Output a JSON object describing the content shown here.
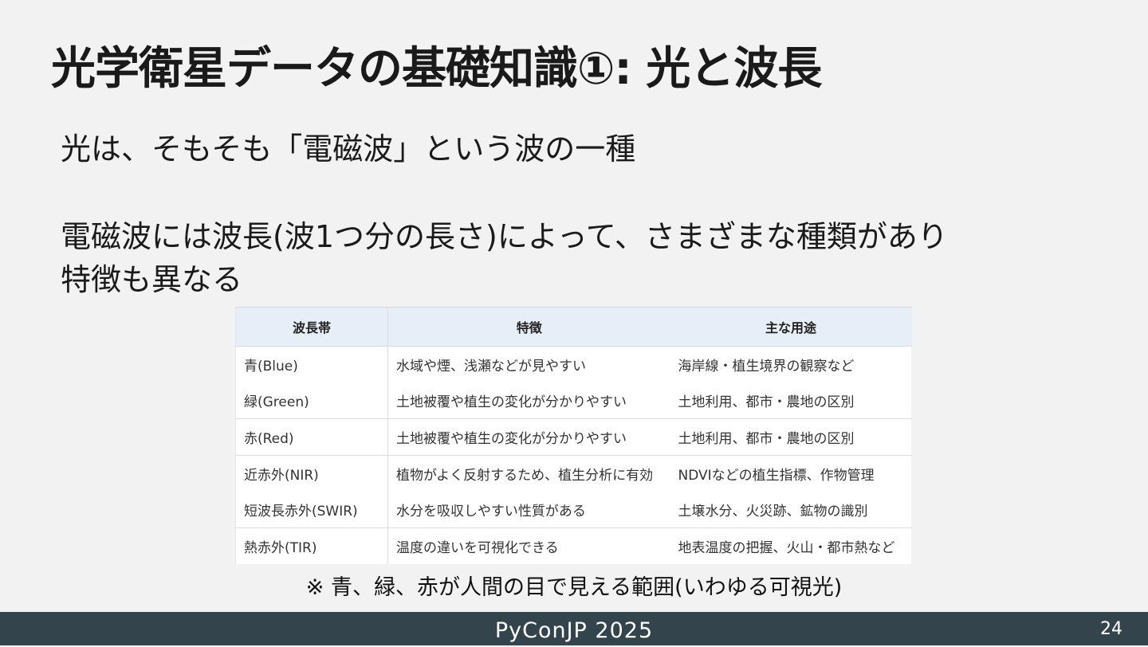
{
  "slide": {
    "title": "光学衛星データの基礎知識①: 光と波長",
    "line1": "光は、そもそも「電磁波」という波の一種",
    "line2": "電磁波には波長(波1つ分の長さ)によって、さまざまな種類があり",
    "line3": "特徴も異なる"
  },
  "table": {
    "headers": [
      "波長帯",
      "特徴",
      "主な用途"
    ],
    "rows": [
      [
        "青(Blue)",
        "水域や煙、浅瀬などが見やすい",
        "海岸線・植生境界の観察など"
      ],
      [
        "緑(Green)",
        "土地被覆や植生の変化が分かりやすい",
        "土地利用、都市・農地の区別"
      ],
      [
        "赤(Red)",
        "土地被覆や植生の変化が分かりやすい",
        "土地利用、都市・農地の区別"
      ],
      [
        "近赤外(NIR)",
        "植物がよく反射するため、植生分析に有効",
        "NDVIなどの植生指標、作物管理"
      ],
      [
        "短波長赤外(SWIR)",
        "水分を吸収しやすい性質がある",
        "土壌水分、火災跡、鉱物の識別"
      ],
      [
        "熱赤外(TIR)",
        "温度の違いを可視化できる",
        "地表温度の把握、火山・都市熱など"
      ]
    ]
  },
  "note": "※ 青、緑、赤が人間の目で見える範囲(いわゆる可視光)",
  "footer": {
    "title": "PyConJP 2025",
    "page": "24"
  }
}
